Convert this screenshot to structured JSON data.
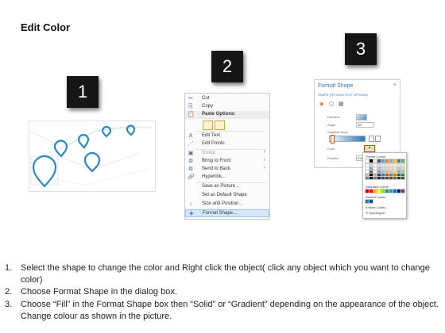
{
  "title": "Edit Color",
  "badges": [
    "1",
    "2",
    "3"
  ],
  "context_menu": {
    "items": [
      {
        "icon": "scissors-icon",
        "label": "Cut",
        "glyph": "✂"
      },
      {
        "icon": "copy-icon",
        "label": "Copy",
        "glyph": "⎘"
      },
      {
        "icon": "paste-icon",
        "label": "Paste Options:",
        "glyph": "📋"
      },
      {
        "icon": "edit-text-icon",
        "label": "Edit Text",
        "glyph": "A"
      },
      {
        "icon": "edit-points-icon",
        "label": "Edit Points",
        "glyph": "⋰"
      },
      {
        "icon": "group-icon",
        "label": "Group",
        "glyph": "▣"
      },
      {
        "icon": "bring-to-front-icon",
        "label": "Bring to Front",
        "glyph": "⧉"
      },
      {
        "icon": "send-to-back-icon",
        "label": "Send to Back",
        "glyph": "⧉"
      },
      {
        "icon": "hyperlink-icon",
        "label": "Hyperlink...",
        "glyph": "🔗"
      },
      {
        "icon": "save-as-picture-icon",
        "label": "Save as Picture...",
        "glyph": ""
      },
      {
        "icon": "set-default-icon",
        "label": "Set as Default Shape",
        "glyph": ""
      },
      {
        "icon": "size-position-icon",
        "label": "Size and Position...",
        "glyph": "↕"
      },
      {
        "icon": "format-shape-icon",
        "label": "Format Shape...",
        "glyph": "◈"
      }
    ]
  },
  "format_pane": {
    "title": "Format Shape",
    "close": "×",
    "tabs": "SHAPE OPTIONS   TEXT OPTIONS",
    "direction_label": "Direction",
    "angle_label": "Angle",
    "angle_value": "45°",
    "gradient_stops_label": "Gradient stops",
    "color_label": "Color",
    "position_label": "Position",
    "position_value": "0%"
  },
  "color_picker": {
    "theme_label": "Theme Colors",
    "standard_label": "Standard Colors",
    "recent_label": "Recent Colors",
    "more_colors": "More Colors...",
    "eyedropper": "Eyedropper",
    "theme_top": [
      "#ffffff",
      "#000000",
      "#e7e6e6",
      "#44546a",
      "#5b9bd5",
      "#ed7d31",
      "#a5a5a5",
      "#ffc000",
      "#4472c4",
      "#70ad47"
    ],
    "standard": [
      "#c00000",
      "#ff0000",
      "#ffc000",
      "#ffff00",
      "#92d050",
      "#00b050",
      "#00b0f0",
      "#0070c0",
      "#002060",
      "#7030a0"
    ],
    "recent": [
      "#2e75b6",
      "#1f4e79"
    ]
  },
  "steps": [
    {
      "num": "1.",
      "text": "Select the shape to change the color and Right click the object( click any object which you want to change color)"
    },
    {
      "num": "2.",
      "text": "Choose Format Shape in the dialog box."
    },
    {
      "num": "3.",
      "text": "Choose “Fill” in the Format Shape box then “Solid” or “Gradient” depending on the appearance of the object. Change colour as shown in the picture."
    }
  ],
  "colors": {
    "pin": "#2b8ab8",
    "highlight": "#d5e6f7",
    "badge": "#161616"
  }
}
